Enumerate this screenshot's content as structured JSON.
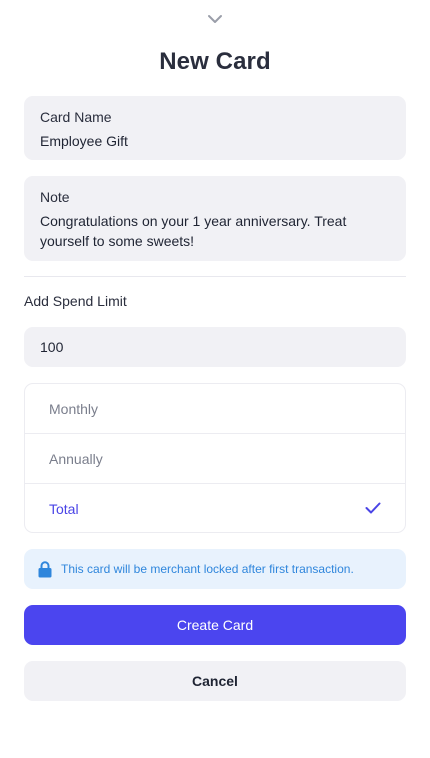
{
  "sheet": {
    "title": "New Card"
  },
  "card_name": {
    "label": "Card Name",
    "value": "Employee Gift"
  },
  "note": {
    "label": "Note",
    "value": "Congratulations on your 1 year anniversary. Treat yourself to some sweets!"
  },
  "spend_limit": {
    "label": "Add Spend Limit",
    "value": "100",
    "periods": [
      {
        "label": "Monthly",
        "selected": false
      },
      {
        "label": "Annually",
        "selected": false
      },
      {
        "label": "Total",
        "selected": true
      }
    ]
  },
  "notice": {
    "text": "This card will be merchant locked after first transaction.",
    "icon": "lock-icon"
  },
  "actions": {
    "create_label": "Create Card",
    "cancel_label": "Cancel"
  },
  "colors": {
    "accent": "#4b45ef",
    "selected_text": "#4a44e6",
    "notice_bg": "#e8f2fd",
    "notice_text": "#2f86dc",
    "field_bg": "#f1f1f5"
  },
  "icons": {
    "handle": "chevron-down-icon",
    "selected": "checkmark-icon"
  }
}
